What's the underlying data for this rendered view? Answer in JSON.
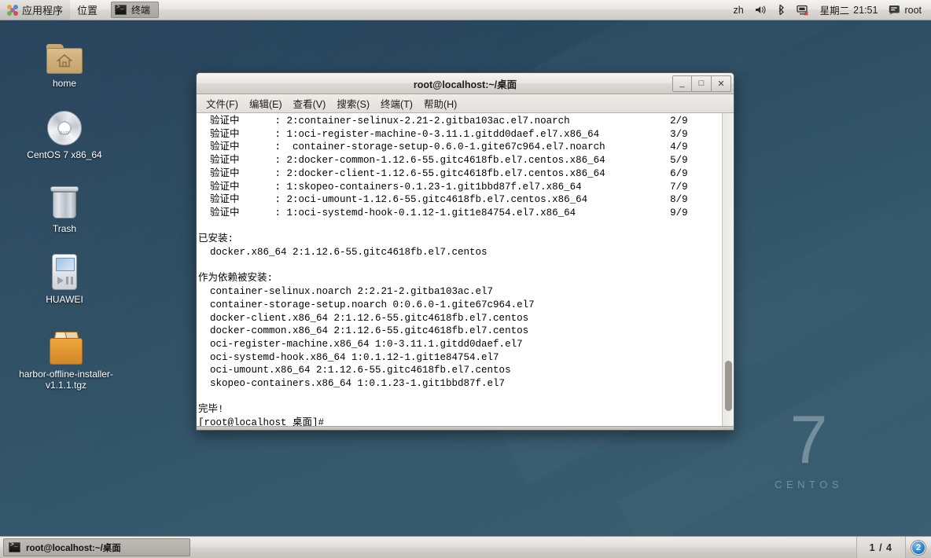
{
  "top_panel": {
    "applications_label": "应用程序",
    "places_label": "位置",
    "active_window_label": "终端",
    "tray": {
      "input_method": "zh",
      "volume_icon": "volume-icon",
      "bluetooth_icon": "bluetooth-icon",
      "network_icon": "network-disconnected-icon",
      "day": "星期二",
      "time": "21:51",
      "user": "root"
    }
  },
  "desktop": {
    "icons": [
      {
        "label": "home",
        "type": "folder"
      },
      {
        "label": "CentOS 7 x86_64",
        "type": "dvd"
      },
      {
        "label": "Trash",
        "type": "trash"
      },
      {
        "label": "HUAWEI",
        "type": "media-player"
      },
      {
        "label": "harbor-offline-installer-v1.1.1.tgz",
        "type": "archive"
      }
    ],
    "watermark": {
      "version": "7",
      "name": "CENTOS"
    },
    "background_color": "#33556a"
  },
  "terminal": {
    "title": "root@localhost:~/桌面",
    "window_buttons": {
      "minimize": "_",
      "maximize": "□",
      "close": "✕"
    },
    "menu": [
      "文件(F)",
      "编辑(E)",
      "查看(V)",
      "搜索(S)",
      "终端(T)",
      "帮助(H)"
    ],
    "content": "  验证中      : 2:container-selinux-2.21-2.gitba103ac.el7.noarch                 2/9\n  验证中      : 1:oci-register-machine-0-3.11.1.gitdd0daef.el7.x86_64            3/9\n  验证中      :  container-storage-setup-0.6.0-1.gite67c964.el7.noarch           4/9\n  验证中      : 2:docker-common-1.12.6-55.gitc4618fb.el7.centos.x86_64           5/9\n  验证中      : 2:docker-client-1.12.6-55.gitc4618fb.el7.centos.x86_64           6/9\n  验证中      : 1:skopeo-containers-0.1.23-1.git1bbd87f.el7.x86_64               7/9\n  验证中      : 2:oci-umount-1.12.6-55.gitc4618fb.el7.centos.x86_64              8/9\n  验证中      : 1:oci-systemd-hook-0.1.12-1.git1e84754.el7.x86_64                9/9\n\n已安装:\n  docker.x86_64 2:1.12.6-55.gitc4618fb.el7.centos\n\n作为依赖被安装:\n  container-selinux.noarch 2:2.21-2.gitba103ac.el7\n  container-storage-setup.noarch 0:0.6.0-1.gite67c964.el7\n  docker-client.x86_64 2:1.12.6-55.gitc4618fb.el7.centos\n  docker-common.x86_64 2:1.12.6-55.gitc4618fb.el7.centos\n  oci-register-machine.x86_64 1:0-3.11.1.gitdd0daef.el7\n  oci-systemd-hook.x86_64 1:0.1.12-1.git1e84754.el7\n  oci-umount.x86_64 2:1.12.6-55.gitc4618fb.el7.centos\n  skopeo-containers.x86_64 1:0.1.23-1.git1bbd87f.el7\n\n完毕!\n[root@localhost 桌面]# "
  },
  "bottom_panel": {
    "task_label": "root@localhost:~/桌面",
    "workspace_indicator": "1 / 4",
    "notification_count": "2"
  }
}
